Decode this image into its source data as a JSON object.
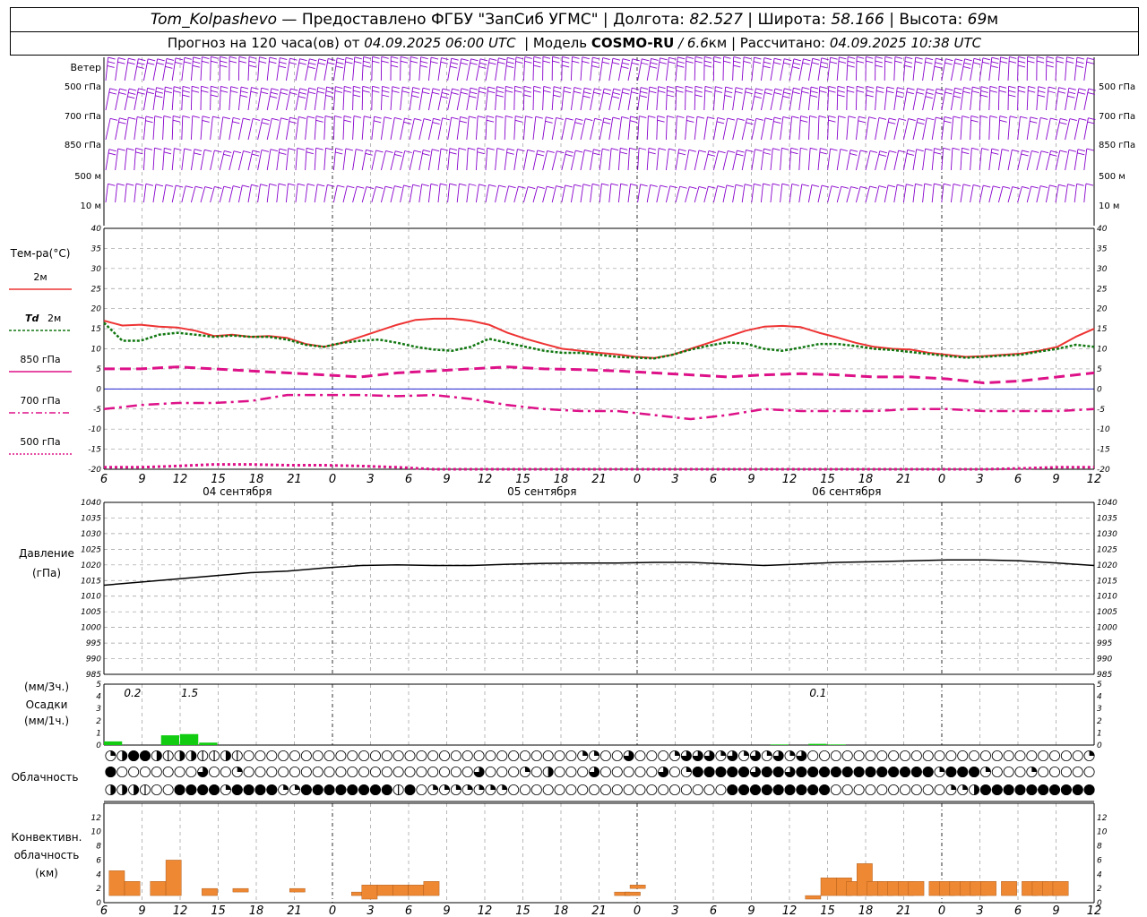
{
  "header": {
    "station": "Tom_Kolpashevo",
    "dash": " — ",
    "provided": "Предоставлено ФГБУ \"ЗапСиб УГМС\"",
    "sep": " | ",
    "lon_label": "Долгота: ",
    "lon": "82.527",
    "lat_label": "Широта: ",
    "lat": "58.166",
    "alt_label": "Высота: ",
    "alt": "69",
    "alt_unit": "м",
    "forecast_label": "Прогноз на 120 часа(ов) от ",
    "forecast_from": "04.09.2025 06:00 UTC",
    "model_label": "Модель ",
    "model": "COSMO-RU",
    "model_res": " / 6.6",
    "model_unit": "км",
    "calc_label": "Рассчитано: ",
    "calc": "04.09.2025 10:38 UTC"
  },
  "colors": {
    "wind": "#8800cc",
    "t2m": "#ee3333",
    "td2m": "#117711",
    "iso": "#dd1188",
    "zero": "#0000cc",
    "precip": "#11cc11",
    "conv": "#ee8833",
    "grid": "#999999"
  },
  "chart_data": [
    {
      "type": "wind-barbs",
      "title": "Ветер",
      "levels": [
        "500 гПа",
        "700 гПа",
        "850 гПа",
        "500 м",
        "10 м"
      ]
    },
    {
      "type": "line",
      "ylabel": "Тем-ра(°С)",
      "ylim": [
        -20,
        40
      ],
      "yticks": [
        40,
        35,
        30,
        25,
        20,
        15,
        10,
        5,
        0,
        -5,
        -10,
        -15,
        -20
      ],
      "x_ticks": [
        "6",
        "9",
        "12",
        "15",
        "18",
        "21",
        "0",
        "3",
        "6",
        "9",
        "12",
        "15",
        "18",
        "21",
        "0",
        "3",
        "6",
        "9",
        "12",
        "15",
        "18",
        "21",
        "0",
        "3",
        "6",
        "9",
        "12"
      ],
      "dates": [
        "04 сентября",
        "05 сентября",
        "06 сентября"
      ],
      "legend": [
        {
          "label": "2м",
          "italic": false
        },
        {
          "label": "2м",
          "prefix": "Td",
          "italic": true
        },
        {
          "label": "850 гПа"
        },
        {
          "label": "700 гПа"
        },
        {
          "label": "500 гПа"
        }
      ],
      "series": [
        {
          "name": "2м",
          "x": [
            0,
            1,
            2,
            3,
            4,
            5,
            6,
            7,
            8,
            9,
            10,
            11,
            12,
            13,
            14,
            15,
            16,
            17,
            18,
            19,
            20,
            21,
            22,
            23,
            24,
            25,
            26,
            27,
            28,
            29,
            30,
            31,
            32,
            33,
            34,
            35,
            36,
            37,
            38,
            39,
            40,
            41,
            42,
            43,
            44,
            45,
            46,
            47,
            48,
            49,
            50,
            51,
            52,
            53,
            54
          ],
          "values": [
            17,
            15.8,
            16,
            15.5,
            15.3,
            14.5,
            13.2,
            13.5,
            13,
            13.2,
            12.7,
            11.2,
            10.5,
            11.5,
            13,
            14.5,
            16,
            17.2,
            17.5,
            17.5,
            17,
            16,
            14,
            12.5,
            11.2,
            10,
            9.5,
            9,
            8.6,
            8,
            7.7,
            8.5,
            10,
            11.5,
            13,
            14.5,
            15.5,
            15.7,
            15.4,
            14,
            12.8,
            11.5,
            10.5,
            10,
            9.8,
            9,
            8.5,
            8,
            8.2,
            8.5,
            8.8,
            9.5,
            10.5,
            13,
            15
          ]
        },
        {
          "name": "Td 2м",
          "x": [
            0,
            1,
            2,
            3,
            4,
            5,
            6,
            7,
            8,
            9,
            10,
            11,
            12,
            13,
            14,
            15,
            16,
            17,
            18,
            19,
            20,
            21,
            22,
            23,
            24,
            25,
            26,
            27,
            28,
            29,
            30,
            31,
            32,
            33,
            34,
            35,
            36,
            37,
            38,
            39,
            40,
            41,
            42,
            43,
            44,
            45,
            46,
            47,
            48,
            49,
            50,
            51,
            52,
            53,
            54
          ],
          "values": [
            16.5,
            12,
            12,
            13.5,
            14,
            13.5,
            13,
            13.3,
            13,
            13,
            12.3,
            11,
            10.5,
            11.5,
            12,
            12.3,
            11.5,
            10.5,
            9.8,
            9.5,
            10.5,
            12.5,
            11.5,
            10.5,
            9.5,
            9,
            9,
            8.5,
            8,
            7.8,
            7.6,
            8.5,
            9.8,
            10.8,
            11.6,
            11.3,
            10,
            9.5,
            10.3,
            11.2,
            11.2,
            10.7,
            10,
            9.7,
            9.2,
            8.7,
            8.2,
            7.8,
            8,
            8.3,
            8.5,
            9.3,
            10,
            11,
            10.5
          ]
        },
        {
          "name": "850 гПа",
          "x": [
            0,
            2,
            4,
            6,
            8,
            10,
            12,
            14,
            16,
            18,
            20,
            22,
            24,
            26,
            28,
            30,
            32,
            34,
            36,
            38,
            40,
            42,
            44,
            46,
            48,
            50,
            52,
            54
          ],
          "values": [
            5,
            5,
            5.5,
            5,
            4.5,
            4,
            3.5,
            3,
            4,
            4.5,
            5,
            5.5,
            5,
            4.8,
            4.5,
            4,
            3.5,
            3,
            3.5,
            3.8,
            3.5,
            3,
            3,
            2.5,
            1.5,
            2,
            3,
            4
          ]
        },
        {
          "name": "700 гПа",
          "x": [
            0,
            2,
            4,
            6,
            8,
            10,
            12,
            14,
            16,
            18,
            20,
            22,
            24,
            26,
            28,
            30,
            32,
            34,
            36,
            38,
            40,
            42,
            44,
            46,
            48,
            50,
            52,
            54
          ],
          "values": [
            -5,
            -4,
            -3.5,
            -3.5,
            -3,
            -1.5,
            -1.5,
            -1.5,
            -1.8,
            -1.5,
            -2.5,
            -4,
            -5,
            -5.5,
            -5.5,
            -6.5,
            -7.5,
            -6.5,
            -5,
            -5.5,
            -5.5,
            -5.5,
            -5,
            -5,
            -5.5,
            -5.5,
            -5.5,
            -5
          ]
        },
        {
          "name": "500 гПа",
          "x": [
            0,
            2,
            4,
            6,
            8,
            10,
            12,
            14,
            16,
            18,
            20,
            22,
            24,
            26,
            28,
            30,
            32,
            34,
            36,
            38,
            40,
            42,
            44,
            46,
            48,
            50,
            52,
            54
          ],
          "values": [
            -19.5,
            -19.5,
            -19.2,
            -18.8,
            -18.8,
            -19,
            -19,
            -19.2,
            -19.5,
            -20,
            -20,
            -20,
            -20,
            -20,
            -20,
            -20,
            -20,
            -20,
            -20,
            -20,
            -20,
            -20,
            -20,
            -20,
            -20,
            -19.8,
            -19.5,
            -19.5
          ]
        }
      ]
    },
    {
      "type": "line",
      "ylabel": "Давление",
      "yunit": "(гПа)",
      "ylim": [
        985,
        1040
      ],
      "yticks": [
        1040,
        1035,
        1030,
        1025,
        1020,
        1015,
        1010,
        1005,
        1000,
        995,
        990,
        985
      ],
      "series": [
        {
          "name": "Давление",
          "x": [
            0,
            2,
            4,
            6,
            8,
            10,
            12,
            14,
            16,
            18,
            20,
            22,
            24,
            26,
            28,
            30,
            32,
            34,
            36,
            38,
            40,
            42,
            44,
            46,
            48,
            50,
            52,
            54
          ],
          "values": [
            1013.5,
            1014.5,
            1015.5,
            1016.5,
            1017.5,
            1018,
            1019,
            1019.8,
            1020,
            1019.8,
            1019.8,
            1020.2,
            1020.5,
            1020.6,
            1020.6,
            1020.8,
            1020.8,
            1020.3,
            1019.8,
            1020.3,
            1020.8,
            1021,
            1021.3,
            1021.6,
            1021.6,
            1021.3,
            1020.6,
            1019.8
          ]
        }
      ]
    },
    {
      "type": "bar",
      "ylabel": "Осадки",
      "unit3h": "(мм/3ч.)",
      "unit1h": "(мм/1ч.)",
      "ylim": [
        0,
        5
      ],
      "yticks": [
        5,
        4,
        3,
        2,
        1,
        0
      ],
      "labels": [
        {
          "x": 1.5,
          "text": "0.2"
        },
        {
          "x": 4.5,
          "text": "1.5"
        },
        {
          "x": 37.5,
          "text": "0.1"
        }
      ],
      "series": [
        {
          "name": "Осадки",
          "x": [
            0,
            3,
            4,
            5,
            35,
            37,
            38
          ],
          "values": [
            0.3,
            0.8,
            0.9,
            0.2,
            0.05,
            0.1,
            0.05
          ]
        }
      ]
    },
    {
      "type": "table",
      "title": "Облачность",
      "rows": [
        "qhffhbhhbbhb00000000000000000000000000000qq00t000qtttqtqtqtqt000000000000000000000000qq0000000000000qqtqqq0t0",
        "f0000000t00q00000000000000000000t000q0h000t00000t0qffffftfftffffffffffffqfffq000q0000000000000000000qqt0fffq",
        "hhhb00ffffqffffqqffffffffbf0qqqqqqq0000000000000000000fffffffff0000000000qqhffffffffffffffff000000000000000000"
      ]
    },
    {
      "type": "bar",
      "ylabel": "Конвективн.",
      "ylabel2": "облачность",
      "ylabel3": "(км)",
      "ylim": [
        0,
        14
      ],
      "yticks": [
        12,
        10,
        8,
        6,
        4,
        2,
        0
      ],
      "series": [
        {
          "name": "Конвективн. облачность",
          "x": [
            0.5,
            2,
            4.5,
            6,
            9.5,
            12.5,
            18,
            24,
            25,
            26.5,
            28,
            29.5,
            31,
            49.5,
            50.5,
            51,
            68,
            69.5,
            71,
            72,
            73,
            74,
            75,
            76,
            77,
            78,
            80,
            81,
            82,
            83,
            84,
            85,
            87,
            89,
            90,
            91,
            92
          ],
          "values": [
            [
              1,
              4.5
            ],
            [
              1,
              3
            ],
            [
              1,
              3
            ],
            [
              1,
              6
            ],
            [
              1,
              2
            ],
            [
              1.5,
              2
            ],
            [
              1.5,
              2
            ],
            [
              1,
              1.5
            ],
            [
              0.5,
              2.5
            ],
            [
              1,
              2.5
            ],
            [
              1,
              2.5
            ],
            [
              1,
              2.5
            ],
            [
              1,
              3
            ],
            [
              1,
              1.5
            ],
            [
              1,
              1.5
            ],
            [
              2,
              2.5
            ],
            [
              0.5,
              1
            ],
            [
              1,
              3.5
            ],
            [
              1,
              3.5
            ],
            [
              1,
              3
            ],
            [
              1,
              5.5
            ],
            [
              1,
              3
            ],
            [
              1,
              3
            ],
            [
              1,
              3
            ],
            [
              1,
              3
            ],
            [
              1,
              3
            ],
            [
              1,
              3
            ],
            [
              1,
              3
            ],
            [
              1,
              3
            ],
            [
              1,
              3
            ],
            [
              1,
              3
            ],
            [
              1,
              3
            ],
            [
              1,
              3
            ],
            [
              1,
              3
            ],
            [
              1,
              3
            ],
            [
              1,
              3
            ],
            [
              1,
              3
            ]
          ]
        }
      ]
    }
  ]
}
